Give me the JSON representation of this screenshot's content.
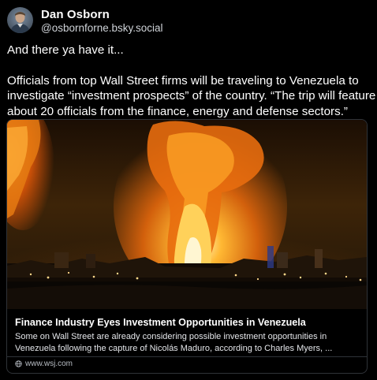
{
  "author": {
    "name": "Dan Osborn",
    "handle": "@osbornforne.bsky.social",
    "avatar_icon": "user-avatar"
  },
  "post": {
    "line1": "And there ya have it...",
    "body_lines": [
      "Officials from top Wall Street firms will be traveling to Venezuela to",
      "investigate “investment prospects” of the country. “The trip will feature",
      "about 20 officials from the finance, energy and defense sectors.”"
    ]
  },
  "link_card": {
    "title": "Finance Industry Eyes Investment Opportunities in Venezuela",
    "description_lines": [
      "Some on Wall Street are already considering possible investment opportunities in",
      "Venezuela following the capture of Nicolás Maduro, according to Charles Myers, ..."
    ],
    "domain": "www.wsj.com",
    "domain_icon": "globe-icon",
    "image_icon": "explosion-night-photo"
  },
  "colors": {
    "background": "#000000",
    "text": "#ffffff",
    "muted": "#b8bdc4",
    "border": "#2f3338"
  }
}
